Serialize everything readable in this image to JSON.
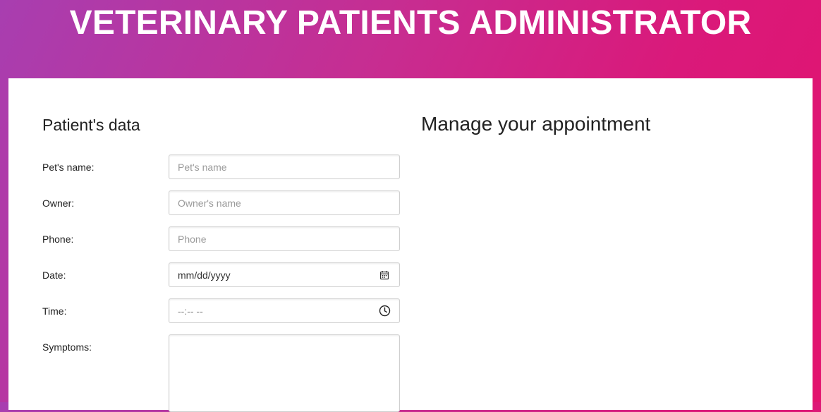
{
  "app": {
    "title": "VETERINARY PATIENTS ADMINISTRATOR"
  },
  "patient_form": {
    "title": "Patient's data",
    "fields": [
      {
        "label": "Pet's name:",
        "placeholder": "Pet's name",
        "value": ""
      },
      {
        "label": "Owner:",
        "placeholder": "Owner's name",
        "value": ""
      },
      {
        "label": "Phone:",
        "placeholder": "Phone",
        "value": ""
      },
      {
        "label": "Date:",
        "display": "mm/dd/yyyy",
        "icon": "calendar-icon"
      },
      {
        "label": "Time:",
        "display": "--:-- --",
        "icon": "clock-icon"
      },
      {
        "label": "Symptoms:",
        "value": ""
      }
    ]
  },
  "appointments": {
    "title": "Manage your appointment"
  },
  "colors": {
    "gradient_start": "#a83eb0",
    "gradient_end": "#e2136e",
    "panel": "#ffffff",
    "title_text": "#ffffff"
  }
}
